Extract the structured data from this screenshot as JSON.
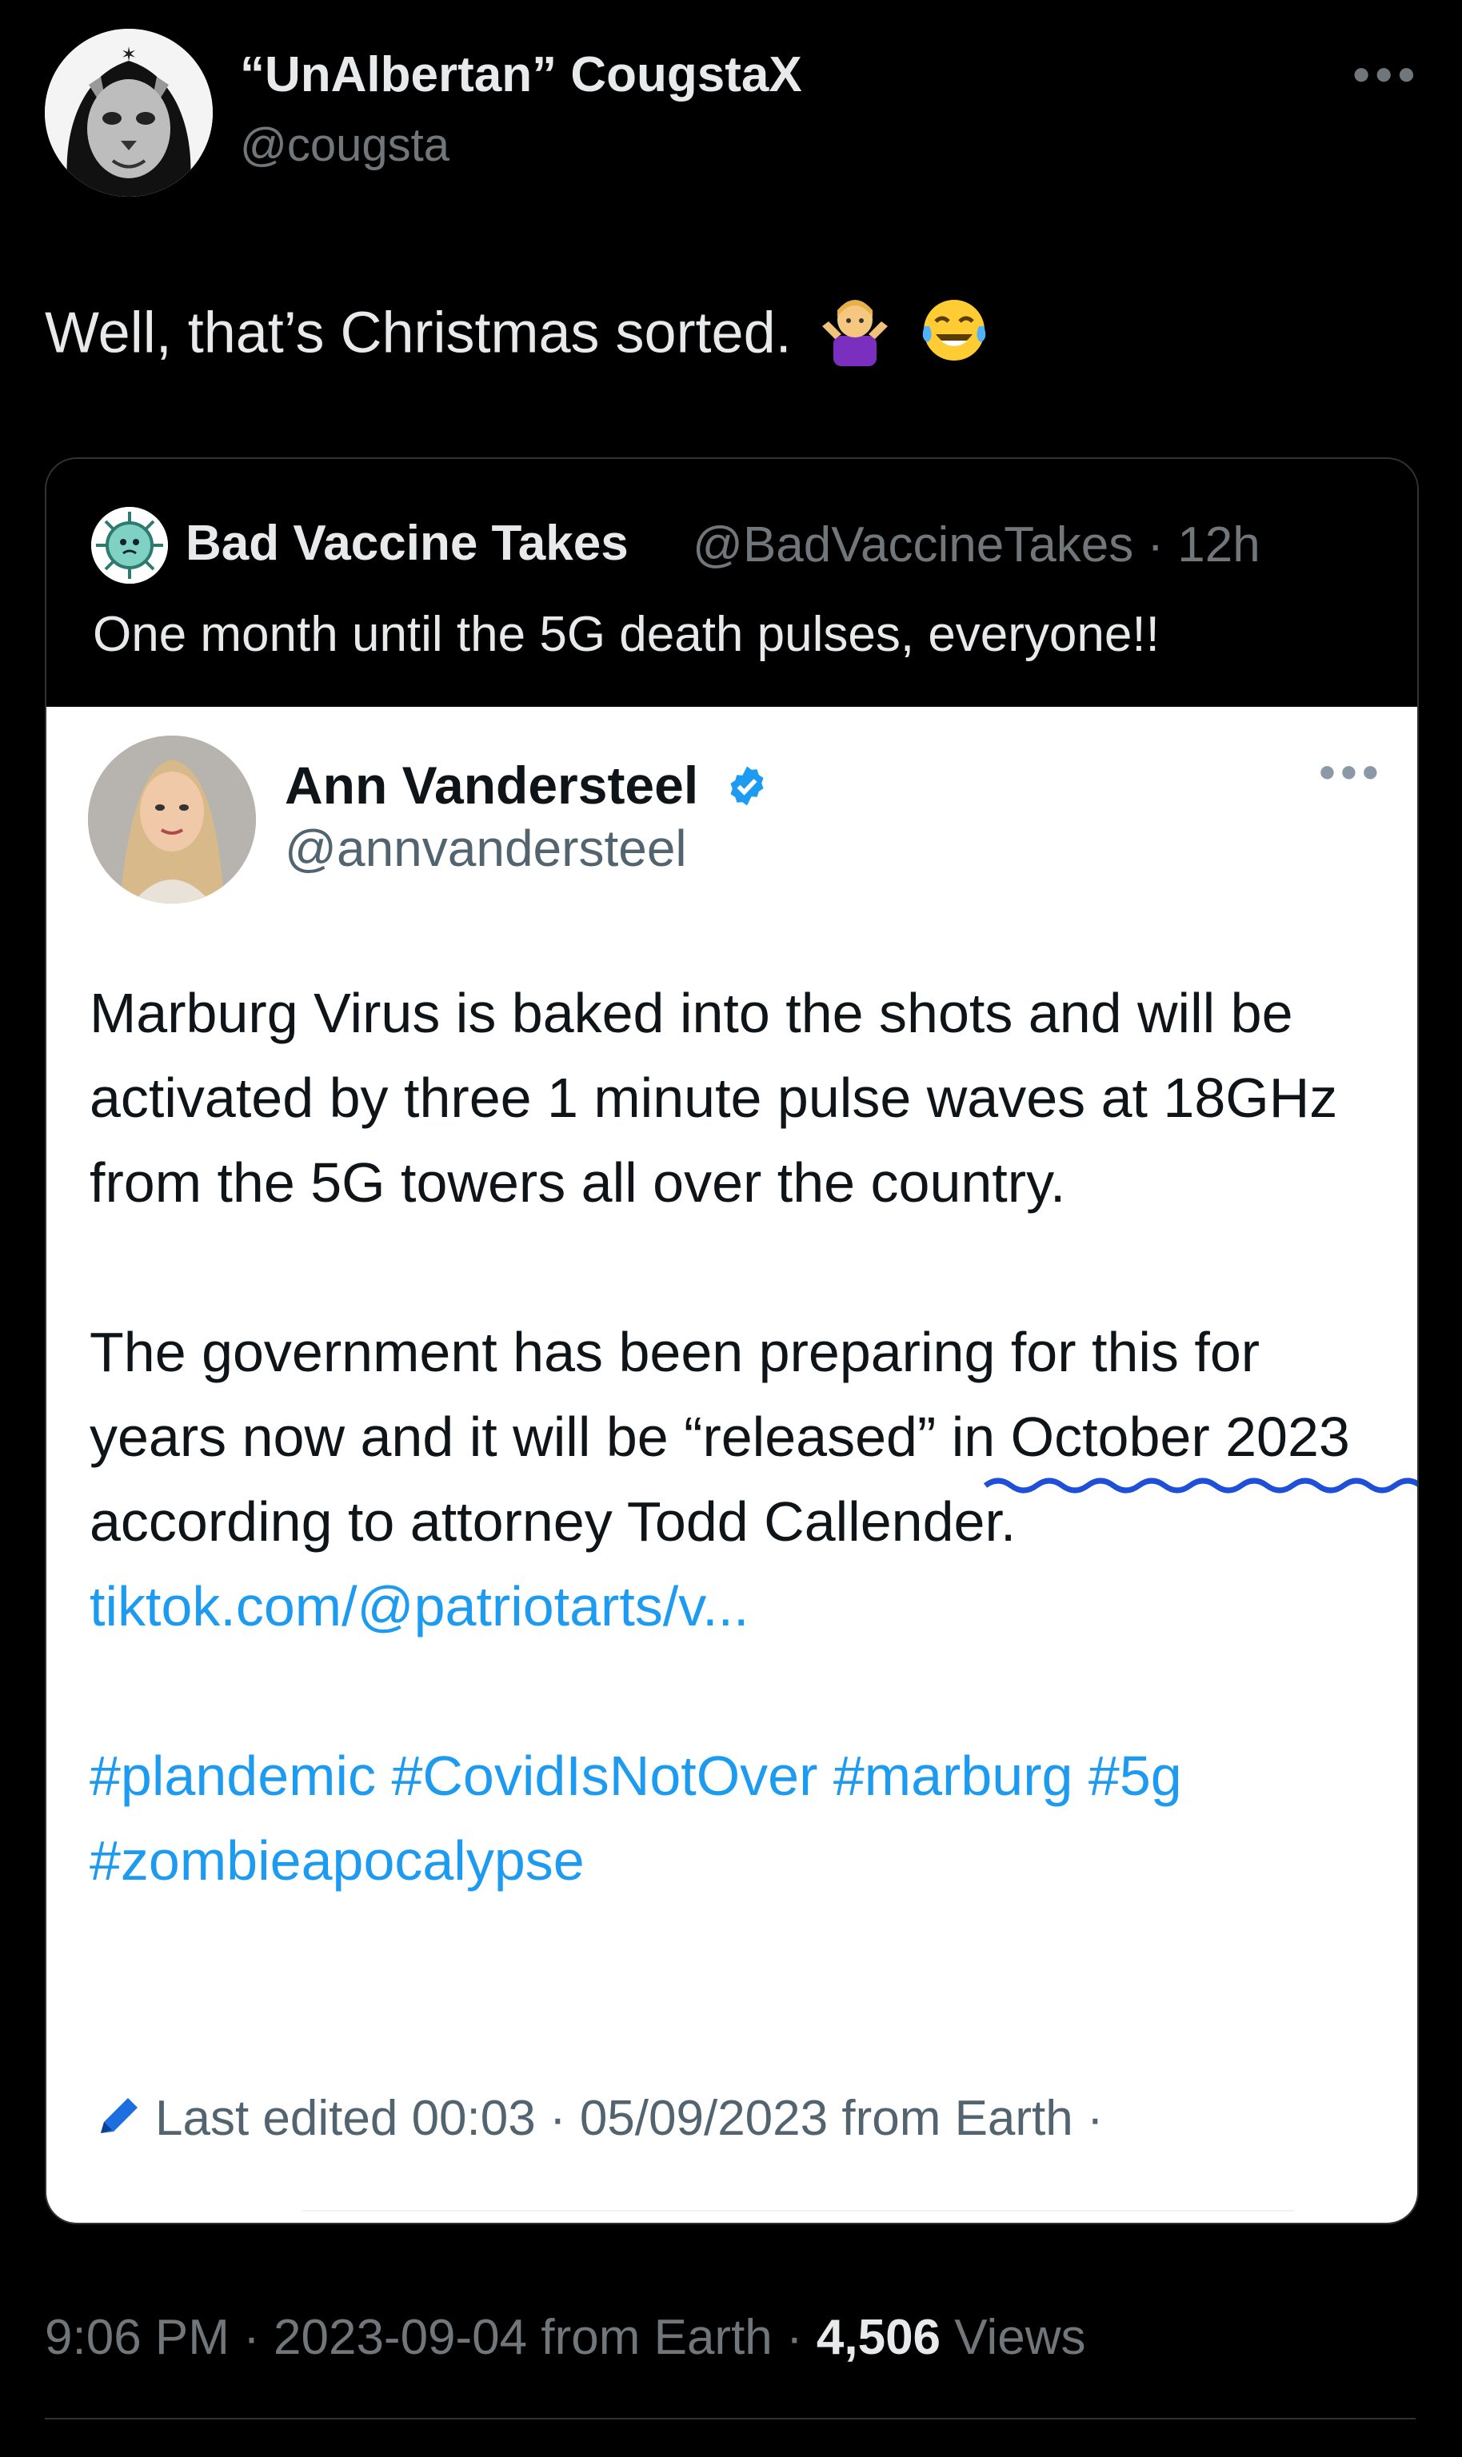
{
  "tweet": {
    "display_name": "“UnAlbertan” CougstaX",
    "handle": "@cougsta",
    "text": "Well, that’s Christmas sorted.",
    "emojis": [
      "person-shrugging-emoji",
      "tears-of-joy-emoji"
    ],
    "timestamp": "9:06 PM · 2023-09-04 from Earth · ",
    "views_count": "4,506",
    "views_label": " Views"
  },
  "quote": {
    "display_name": "Bad Vaccine Takes",
    "handle": "@BadVaccineTakes",
    "age": " · 12h",
    "text": "One month until the 5G death pulses, everyone!!"
  },
  "embedded": {
    "display_name": "Ann Vandersteel",
    "handle": "@annvandersteel",
    "para1": "Marburg Virus is baked into the shots and will be activated by three 1 minute pulse waves at 18GHz from the 5G towers all over the country.",
    "para2_a": "The government has been preparing for this for years now and it will be “released” in ",
    "para2_underlined": "October 2023",
    "para2_b": " according to attorney Todd Callender. ",
    "link": "tiktok.com/@patriotarts/v...",
    "hashtags_line1": "#plandemic #CovidIsNotOver #marburg  #5g",
    "hashtags_line2": "#zombieapocalypse",
    "edited": "Last edited 00:03 · 05/09/2023  from Earth ·"
  },
  "colors": {
    "background": "#000000",
    "text_primary": "#e7e9ea",
    "text_secondary": "#71767b",
    "link_blue": "#1d9bf0",
    "verified_blue": "#1d9bf0"
  },
  "icons": [
    "more-icon",
    "verified-badge-icon",
    "pencil-icon"
  ]
}
